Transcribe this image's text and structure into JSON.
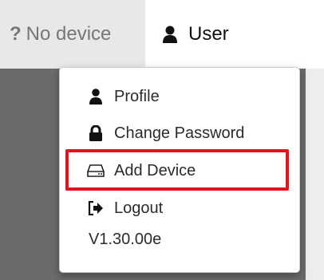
{
  "navbar": {
    "device_prefix": "?",
    "device_status": "No device",
    "user_label": "User"
  },
  "menu": {
    "items": [
      {
        "label": "Profile",
        "icon": "user-icon"
      },
      {
        "label": "Change Password",
        "icon": "lock-icon"
      },
      {
        "label": "Add Device",
        "icon": "hard-drive-icon"
      },
      {
        "label": "Logout",
        "icon": "logout-icon"
      }
    ],
    "version": "V1.30.00e"
  },
  "colors": {
    "highlight": "#e0141e",
    "backdrop": "#6b6b6b"
  }
}
